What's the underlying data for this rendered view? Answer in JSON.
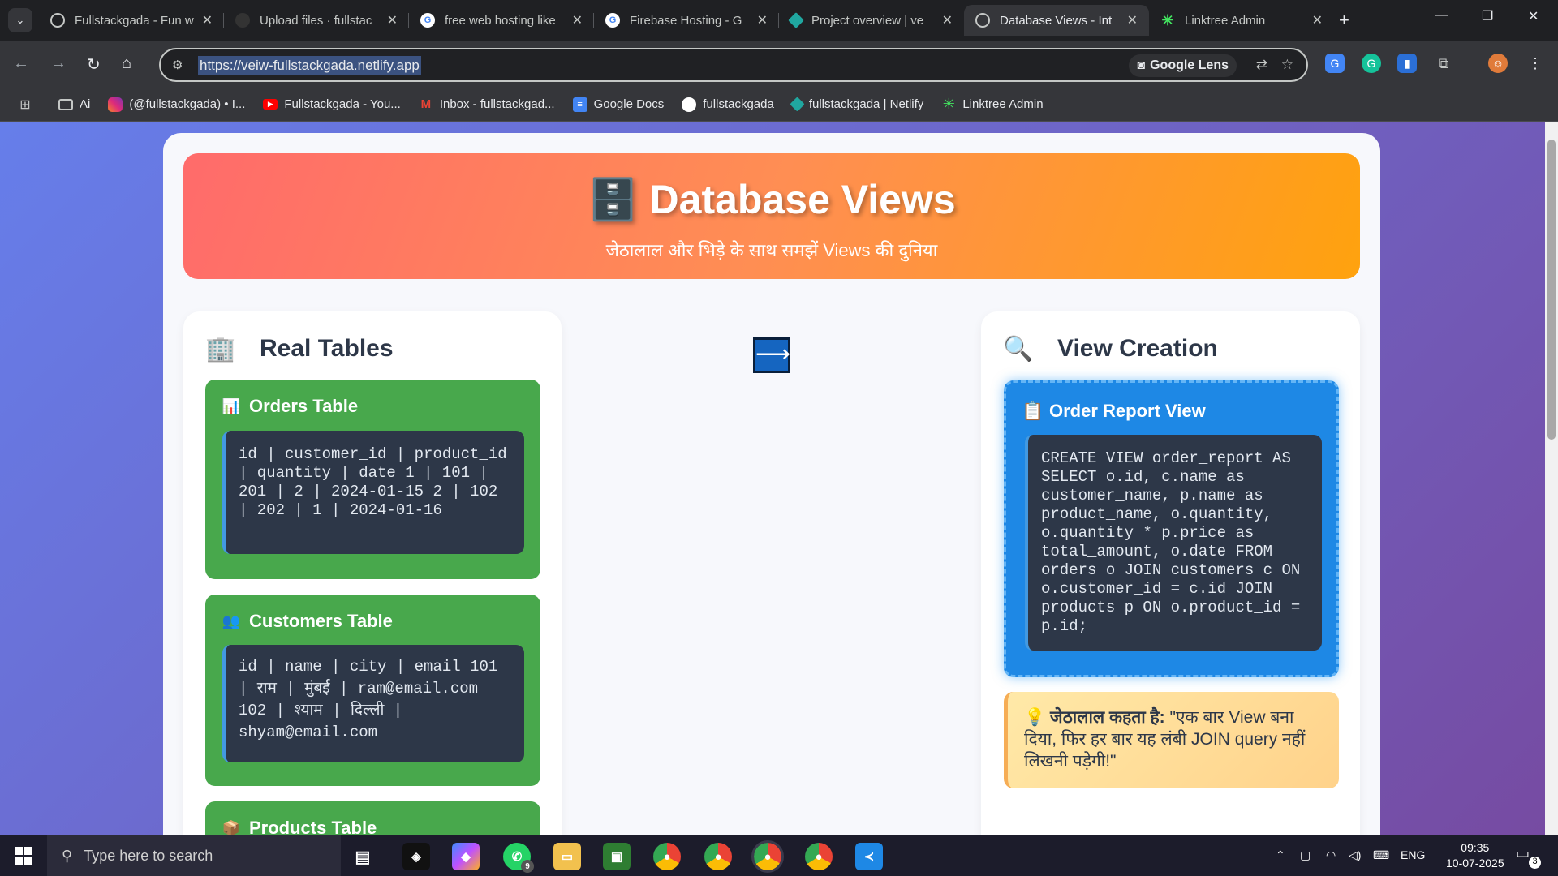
{
  "browser": {
    "tabs": [
      {
        "title": "Fullstackgada - Fun w",
        "favicon": "globe-icon",
        "active": false
      },
      {
        "title": "Upload files · fullstac",
        "favicon": "github-icon",
        "active": false
      },
      {
        "title": "free web hosting like",
        "favicon": "google-icon",
        "active": false
      },
      {
        "title": "Firebase Hosting - G",
        "favicon": "google-icon",
        "active": false
      },
      {
        "title": "Project overview | ve",
        "favicon": "netlify-icon",
        "active": false
      },
      {
        "title": "Database Views - Int",
        "favicon": "globe-icon",
        "active": true
      },
      {
        "title": "Linktree Admin",
        "favicon": "linktree-icon",
        "active": false
      }
    ],
    "url": "https://veiw-fullstackgada.netlify.app",
    "lens_label": "Google Lens",
    "bookmarks": [
      {
        "label": "Ai",
        "icon": "folder-icon"
      },
      {
        "label": "(@fullstackgada) • I...",
        "icon": "instagram-icon"
      },
      {
        "label": "Fullstackgada - You...",
        "icon": "youtube-icon"
      },
      {
        "label": "Inbox - fullstackgad...",
        "icon": "gmail-icon"
      },
      {
        "label": "Google Docs",
        "icon": "docs-icon"
      },
      {
        "label": "fullstackgada",
        "icon": "github-icon"
      },
      {
        "label": "fullstackgada | Netlify",
        "icon": "netlify-icon"
      },
      {
        "label": "Linktree Admin",
        "icon": "linktree-icon"
      }
    ]
  },
  "page": {
    "header": {
      "icon": "🗄️",
      "title": "Database Views",
      "subtitle": "जेठालाल और भिड़े के साथ समझें Views की दुनिया"
    },
    "real_tables": {
      "icon": "🏢",
      "heading": "Real Tables",
      "tables": [
        {
          "icon": "📊",
          "title": "Orders Table",
          "code": "id | customer_id | product_id | quantity | date 1 | 101 | 201 | 2 | 2024-01-15 2 | 102 | 202 | 1 | 2024-01-16"
        },
        {
          "icon": "👥",
          "title": "Customers Table",
          "code": "id | name | city | email 101 | राम | मुंबई | ram@email.com 102 | श्याम | दिल्ली | shyam@email.com"
        },
        {
          "icon": "📦",
          "title": "Products Table"
        }
      ]
    },
    "arrow": "⟶",
    "view_creation": {
      "icon": "🔍",
      "heading": "View Creation",
      "view_card": {
        "icon": "📋",
        "title": "Order Report View",
        "code": "CREATE VIEW order_report AS SELECT o.id, c.name as customer_name, p.name as product_name, o.quantity, o.quantity * p.price as total_amount, o.date FROM orders o JOIN customers c ON o.customer_id = c.id JOIN products p ON o.product_id = p.id;"
      },
      "tip": {
        "icon": "💡",
        "speaker": "जेठालाल कहता है:",
        "quote": " \"एक बार View बना दिया, फिर हर बार यह लंबी JOIN query नहीं लिखनी पड़ेगी!\""
      }
    }
  },
  "taskbar": {
    "search_placeholder": "Type here to search",
    "whatsapp_badge": "9",
    "language": "ENG",
    "time": "09:35",
    "date": "10-07-2025",
    "notification_count": "3"
  }
}
